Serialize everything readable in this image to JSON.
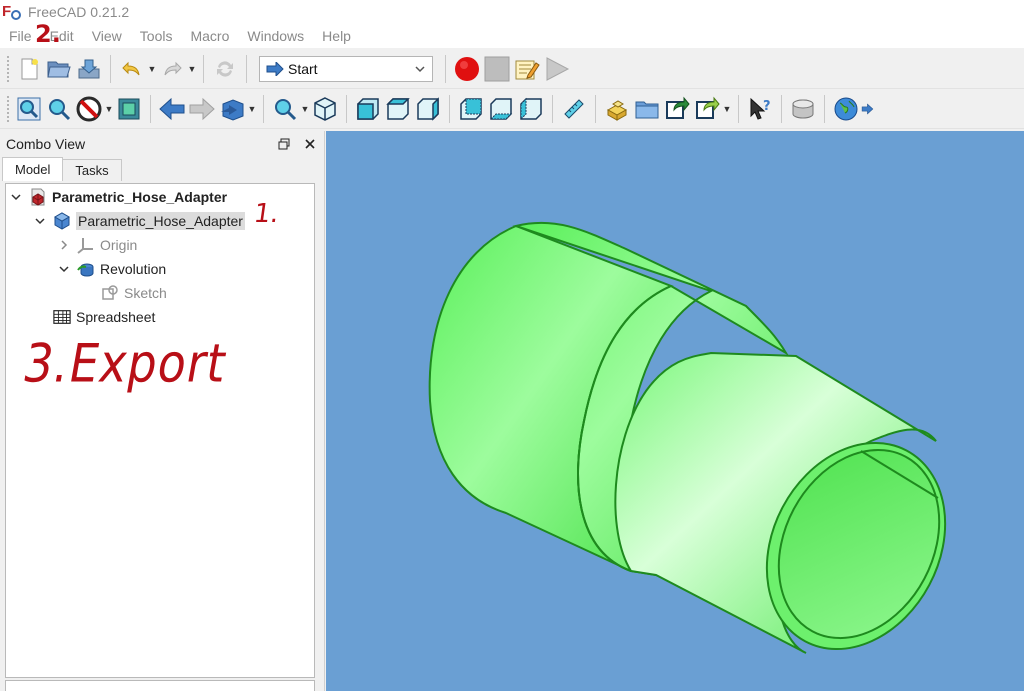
{
  "window": {
    "title": "FreeCAD 0.21.2"
  },
  "menu": [
    "File",
    "Edit",
    "View",
    "Tools",
    "Macro",
    "Windows",
    "Help"
  ],
  "toolbar": {
    "workbench": {
      "selected": "Start"
    }
  },
  "combo_view": {
    "title": "Combo View",
    "tabs": [
      "Model",
      "Tasks"
    ],
    "tree": {
      "document": "Parametric_Hose_Adapter",
      "body": "Parametric_Hose_Adapter",
      "origin": "Origin",
      "revolution": "Revolution",
      "sketch": "Sketch",
      "spreadsheet": "Spreadsheet"
    }
  },
  "annotations": {
    "step1": "1.",
    "step2": "2.",
    "step3": "3.Export"
  },
  "colors": {
    "viewport_bg": "#6a9fd3",
    "part_fill": "#5ef55e",
    "annotation": "#b80f17"
  }
}
